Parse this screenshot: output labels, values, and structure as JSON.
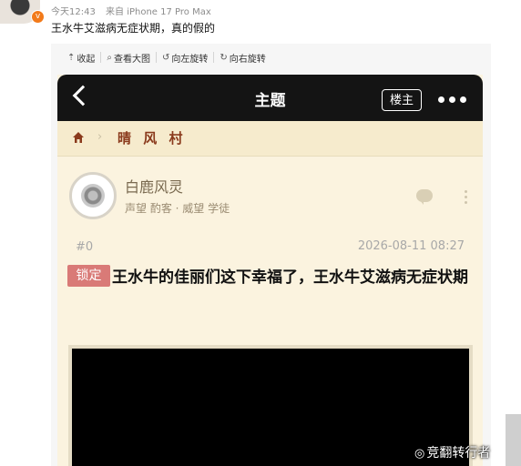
{
  "post": {
    "time": "今天12:43",
    "source": "来自 iPhone 17 Pro Max",
    "text": "王水牛艾滋病无症状期，真的假的",
    "verified_badge": "v"
  },
  "image_toolbar": {
    "collapse": "收起",
    "view_large": "查看大图",
    "rotate_left": "向左旋转",
    "rotate_right": "向右旋转"
  },
  "screenshot": {
    "header": {
      "title": "主题",
      "floor_owner_button": "楼主"
    },
    "breadcrumb": {
      "forum": "晴 风 村"
    },
    "author": {
      "name": "白鹿风灵",
      "meta": "声望 酌客 · 威望 学徒"
    },
    "floor": "#0",
    "date": "2026-08-11 08:27",
    "lock_label": "锁定",
    "title": "王水牛的佳丽们这下幸福了，王水牛艾滋病无症状期"
  },
  "watermark": "竞翻转行者",
  "colors": {
    "header": "#141414",
    "page_bg": "#fbf3df",
    "forum_name": "#8a3a1c",
    "lock_badge": "#d97a77"
  }
}
